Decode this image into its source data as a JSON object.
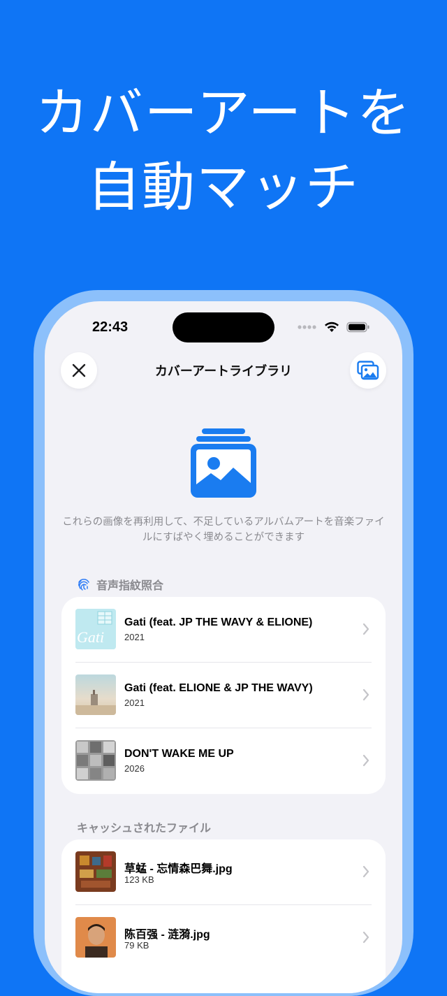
{
  "headline": {
    "line1": "カバーアートを",
    "line2": "自動マッチ"
  },
  "status_bar": {
    "time": "22:43",
    "icons": [
      "cellular-icon",
      "wifi-icon",
      "battery-icon"
    ]
  },
  "nav": {
    "title": "カバーアートライブラリ",
    "close_icon": "close-icon",
    "gallery_icon": "photo-gallery-icon"
  },
  "intro_text": "これらの画像を再利用して、不足しているアルバムアートを音楽ファイルにすばやく埋めることができます",
  "sections": {
    "fingerprint": {
      "title": "音声指紋照合",
      "icon": "fingerprint-icon",
      "items": [
        {
          "title": "Gati (feat. JP THE WAVY & ELIONE)",
          "subtitle": "2021"
        },
        {
          "title": "Gati (feat. ELIONE & JP THE WAVY)",
          "subtitle": "2021"
        },
        {
          "title": "DON'T WAKE ME UP",
          "subtitle": "2026"
        }
      ]
    },
    "cached": {
      "title": "キャッシュされたファイル",
      "items": [
        {
          "title": "草蜢 - 忘情森巴舞.jpg",
          "subtitle": "123 KB"
        },
        {
          "title": "陈百强 - 涟漪.jpg",
          "subtitle": "79 KB"
        }
      ]
    }
  },
  "thumb_texts": {
    "gati": "Gati"
  },
  "colors": {
    "background": "#0f75f5",
    "accent": "#1a7cf0",
    "frame": "#8cc0fb",
    "screen": "#f2f2f7"
  }
}
